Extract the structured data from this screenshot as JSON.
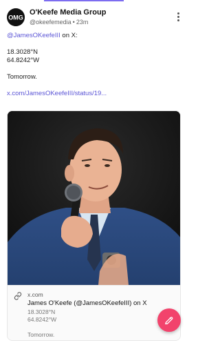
{
  "post": {
    "author_name": "O'Keefe Media Group",
    "handle": "@okeefemedia",
    "separator": "•",
    "time": "23m",
    "mention": "@JamesOKeefeIII",
    "mention_suffix": " on X:",
    "coords_lat": "18.3028°N",
    "coords_lon": "64.8242°W",
    "message": "Tomorrow.",
    "link": "x.com/JamesOKeefeIII/status/19..."
  },
  "embed": {
    "domain": "x.com",
    "title": "James O'Keefe (@JamesOKeefeIII) on X",
    "desc_lat": "18.3028°N",
    "desc_lon": "64.8242°W",
    "desc_message": "Tomorrow."
  },
  "icons": {
    "avatar": "omg-logo",
    "more": "vertical-ellipsis-icon",
    "link": "link-icon",
    "compose": "compose-edit-icon"
  },
  "colors": {
    "accent": "#7c6cf0",
    "link": "#5b55d6",
    "fab": "#f2436c"
  }
}
